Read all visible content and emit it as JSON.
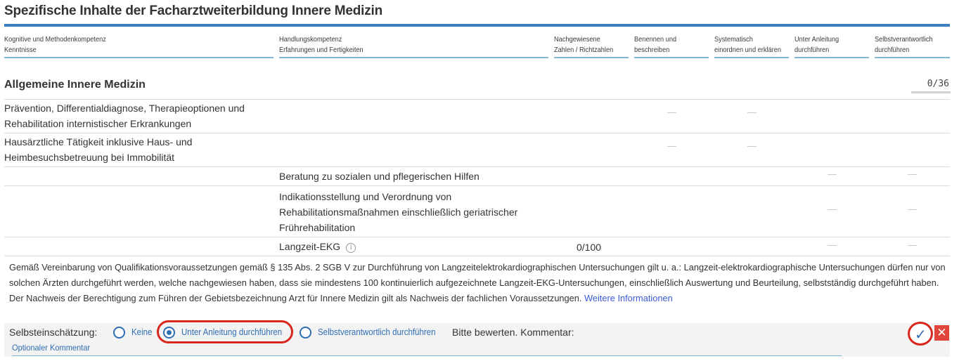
{
  "page": {
    "title": "Spezifische Inhalte der Facharztweiterbildung Innere Medizin"
  },
  "columns": [
    {
      "line1": "Kognitive und Methodenkompetenz",
      "line2": "Kenntnisse"
    },
    {
      "line1": "Handlungskompetenz",
      "line2": "Erfahrungen und Fertigkeiten"
    },
    {
      "line1": "Nachgewiesene",
      "line2": "Zahlen / Richtzahlen"
    },
    {
      "line1": "Benennen und",
      "line2": "beschreiben"
    },
    {
      "line1": "Systematisch",
      "line2": "einordnen und erklären"
    },
    {
      "line1": "Unter Anleitung",
      "line2": "durchführen"
    },
    {
      "line1": "Selbstverantwortlich",
      "line2": "durchführen"
    }
  ],
  "section": {
    "title": "Allgemeine Innere Medizin",
    "counter": "0/36"
  },
  "rows": [
    {
      "kenntnisse": "Prävention, Differentialdiagnose, Therapieoptionen und Rehabilitation internistischer Erkrankungen",
      "fertigkeiten": "",
      "zahlen": ""
    },
    {
      "kenntnisse": "Hausärztliche Tätigkeit inklusive Haus- und Heimbesuchsbetreuung bei Immobilität",
      "fertigkeiten": "",
      "zahlen": ""
    },
    {
      "kenntnisse": "",
      "fertigkeiten": "Beratung zu sozialen und pflegerischen Hilfen",
      "zahlen": ""
    },
    {
      "kenntnisse": "",
      "fertigkeiten": "Indikationsstellung und Verordnung von Rehabilitationsmaßnahmen einschließlich geriatrischer Frührehabilitation",
      "zahlen": ""
    },
    {
      "kenntnisse": "",
      "fertigkeiten": "Langzeit-EKG",
      "zahlen": "0/100"
    }
  ],
  "dash_symbol": "—",
  "info_symbol": "i",
  "note": {
    "text": "Gemäß Vereinbarung von Qualifikationsvoraussetzungen gemäß § 135 Abs. 2 SGB V zur Durchführung von Langzeitelektrokardiographischen Untersuchungen gilt u. a.: Langzeit-elektrokardiographische Untersuchungen dürfen nur von solchen Ärzten durchgeführt werden, welche nachgewiesen haben, dass sie mindestens 100 kontinuierlich aufgezeichnete Langzeit-EKG-Untersuchungen, einschließlich Auswertung und Beurteilung, selbstständig durchgeführt haben. Der Nachweis der Berechtigung zum Führen der Gebietsbezeichnung Arzt für Innere Medizin gilt als Nachweis der fachlichen Voraussetzungen.",
    "link": "Weitere Informationen"
  },
  "self_assessment": {
    "label": "Selbsteinschätzung:",
    "options": [
      "Keine",
      "Unter Anleitung durchführen",
      "Selbstverantwortlich durchführen"
    ],
    "selected": "Unter Anleitung durchführen",
    "rate_text": "Bitte bewerten. Kommentar:",
    "comment_placeholder": "Optionaler Kommentar",
    "confirm_symbol": "✓",
    "cancel_symbol": "✕"
  },
  "colors": {
    "accent": "#3a7fbf",
    "column_rule": "#7fb6d9",
    "radio": "#2f6db3",
    "highlight": "#d9261c",
    "cancel": "#e0443b",
    "link": "#3c5ad6"
  }
}
